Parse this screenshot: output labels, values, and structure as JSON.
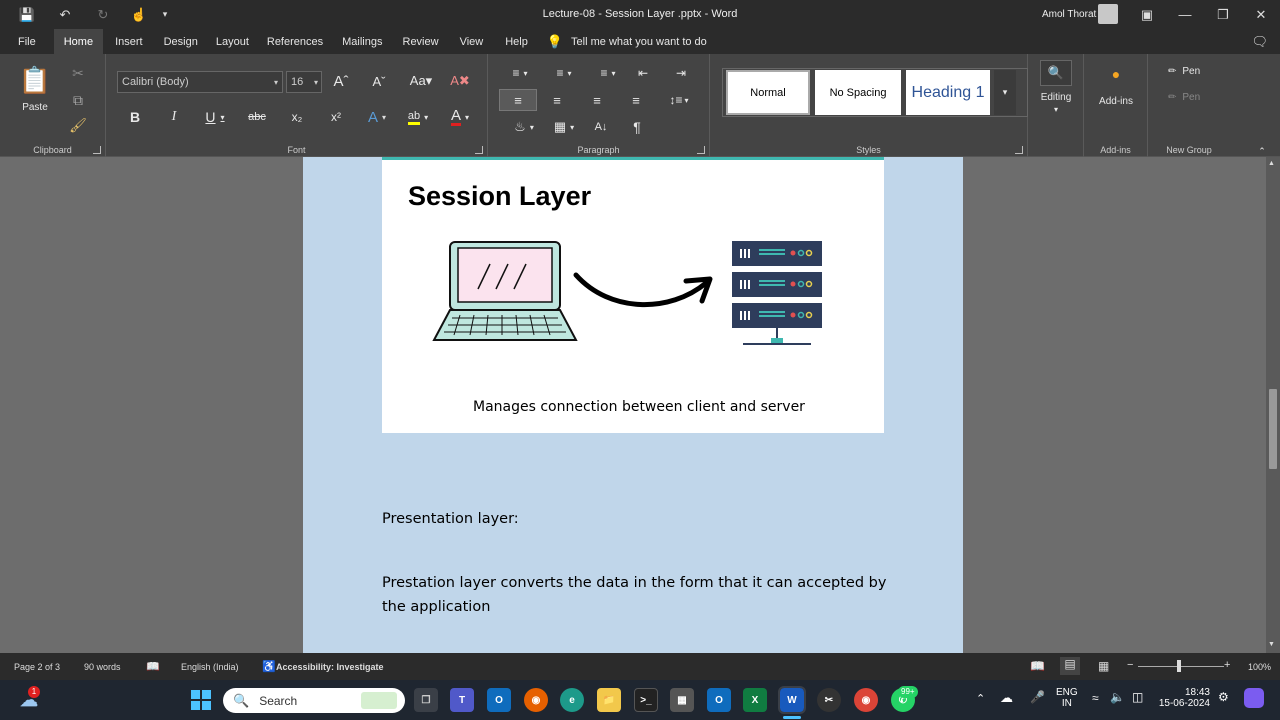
{
  "window": {
    "title": "Lecture-08 - Session Layer .pptx - Word",
    "user": "Amol Thorat"
  },
  "tabs": [
    {
      "label": "File"
    },
    {
      "label": "Home"
    },
    {
      "label": "Insert"
    },
    {
      "label": "Design"
    },
    {
      "label": "Layout"
    },
    {
      "label": "References"
    },
    {
      "label": "Mailings"
    },
    {
      "label": "Review"
    },
    {
      "label": "View"
    },
    {
      "label": "Help"
    }
  ],
  "tellme": "Tell me what you want to do",
  "ribbon": {
    "clipboard": {
      "label": "Clipboard",
      "paste": "Paste"
    },
    "font": {
      "label": "Font",
      "name": "Calibri (Body)",
      "size": "16"
    },
    "paragraph": {
      "label": "Paragraph"
    },
    "styles": {
      "label": "Styles",
      "items": [
        "Normal",
        "No Spacing",
        "Heading 1"
      ]
    },
    "editing": {
      "label": "Editing"
    },
    "addins": {
      "label": "Add-ins",
      "button": "Add-ins"
    },
    "newgroup": {
      "label": "New Group",
      "pen1": "Pen",
      "pen2": "Pen"
    }
  },
  "document": {
    "slide_title": "Session Layer",
    "slide_caption": "Manages connection between client and server",
    "heading": "Presentation layer:",
    "paragraph": "Prestation layer converts the data in the form that it can accepted by the application"
  },
  "status": {
    "page": "Page 2 of 3",
    "words": "90 words",
    "language": "English (India)",
    "accessibility": "Accessibility: Investigate",
    "zoom": "100%"
  },
  "taskbar": {
    "search": "Search",
    "notif_badge": "1",
    "whatsapp_badge": "99+",
    "lang1": "ENG",
    "lang2": "IN",
    "time": "18:43",
    "date": "15-06-2024"
  },
  "colors": {
    "accent_teal": "#3fb8b0",
    "page_bg": "#c0d6ea",
    "server_blue": "#2e3d5c"
  }
}
